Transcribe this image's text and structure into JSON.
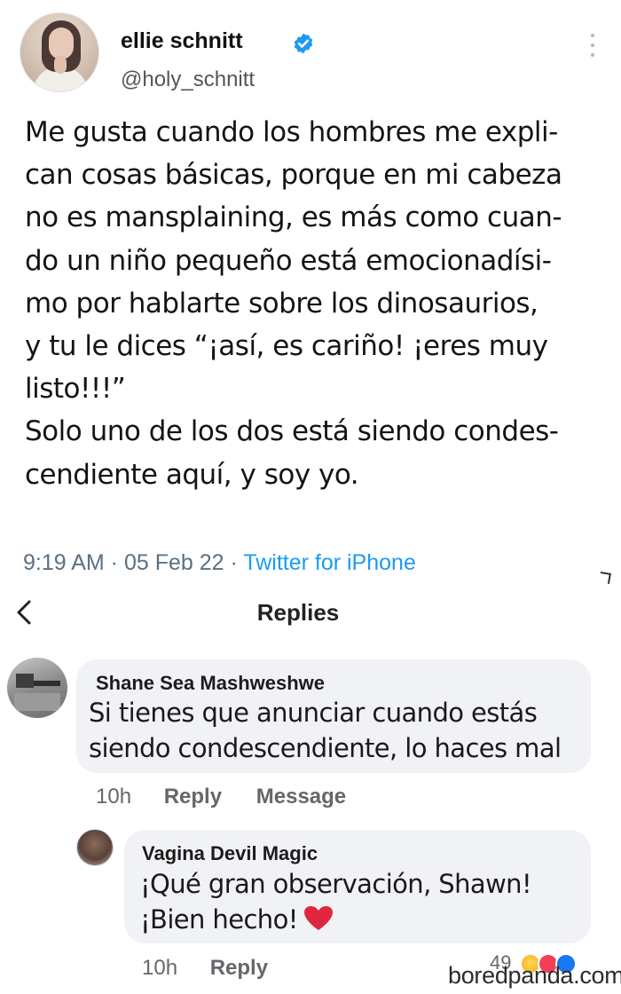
{
  "tweet": {
    "author_name": "ellie schnitt",
    "handle": "@holy_schnitt",
    "text_lines": [
      "Me gusta cuando los hombres me expli-",
      "can cosas básicas, porque en mi cabeza",
      "no es mansplaining, es más como cuan-",
      "do un niño pequeño está emocionadísi-",
      "mo por hablarte sobre los dinosaurios,",
      "y tu le dices “¡así, es cariño! ¡eres muy",
      "listo!!!”",
      "Solo uno de los dos está siendo condes-",
      "cendiente aquí, y soy yo."
    ],
    "meta": {
      "time": "9:19 AM",
      "sep1": " · ",
      "date": "05 Feb 22",
      "sep2": " · ",
      "source": "Twitter for iPhone"
    }
  },
  "replies_header": {
    "title": "Replies"
  },
  "comments": [
    {
      "author": "Shane Sea Mashweshwe",
      "text_lines": [
        "Si tienes que anunciar cuando estás",
        "siendo condescendiente, lo haces mal"
      ],
      "time": "10h",
      "reply_label": "Reply",
      "message_label": "Message"
    },
    {
      "author": "Vagina Devil Magic",
      "text_lines": [
        "¡Qué gran observación, Shawn!",
        "¡Bien hecho!"
      ],
      "time": "10h",
      "reply_label": "Reply",
      "reaction_count": "49"
    }
  ],
  "colors": {
    "verified_blue": "#1d9bf0",
    "bubble_bg": "#f0f2f5",
    "heart_red": "#e0263f"
  },
  "icons": [
    "verified-badge-icon",
    "more-icon",
    "back-chevron-icon",
    "heart-emoji-icon",
    "haha-reaction-icon",
    "love-reaction-icon",
    "like-reaction-icon"
  ],
  "watermark": "boredpanda.com"
}
